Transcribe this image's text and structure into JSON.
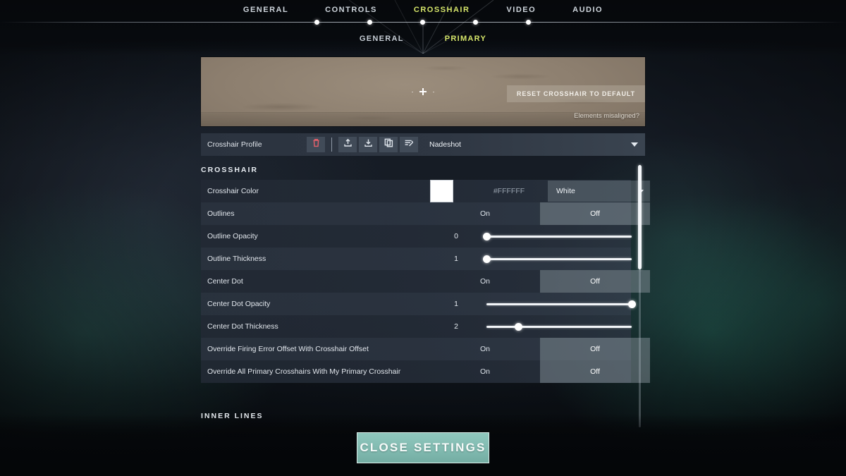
{
  "nav": {
    "tabs": [
      {
        "label": "GENERAL",
        "active": false
      },
      {
        "label": "CONTROLS",
        "active": false
      },
      {
        "label": "CROSSHAIR",
        "active": true
      },
      {
        "label": "VIDEO",
        "active": false
      },
      {
        "label": "AUDIO",
        "active": false
      }
    ],
    "subtabs": [
      {
        "label": "GENERAL",
        "active": false
      },
      {
        "label": "PRIMARY",
        "active": true
      }
    ],
    "active_color": "#D6E66A"
  },
  "preview": {
    "reset_button": "RESET CROSSHAIR TO DEFAULT",
    "misaligned_link": "Elements misaligned?"
  },
  "profile": {
    "label": "Crosshair Profile",
    "selected": "Nadeshot",
    "icons": [
      {
        "name": "delete-icon",
        "glyph": "trash"
      },
      {
        "name": "import-icon",
        "glyph": "upload"
      },
      {
        "name": "export-icon",
        "glyph": "download"
      },
      {
        "name": "duplicate-icon",
        "glyph": "copy"
      },
      {
        "name": "rename-icon",
        "glyph": "edit-list"
      }
    ]
  },
  "sections": {
    "crosshair_title": "CROSSHAIR",
    "inner_lines_title": "INNER LINES"
  },
  "rows": [
    {
      "label": "Crosshair Color",
      "type": "color",
      "hex": "#FFFFFF",
      "swatch_color": "#FFFFFF",
      "preset": "White"
    },
    {
      "label": "Outlines",
      "type": "toggle",
      "options": [
        "On",
        "Off"
      ],
      "selected": "Off"
    },
    {
      "label": "Outline Opacity",
      "type": "slider",
      "value": "0",
      "percent": 0
    },
    {
      "label": "Outline Thickness",
      "type": "slider",
      "value": "1",
      "percent": 0
    },
    {
      "label": "Center Dot",
      "type": "toggle",
      "options": [
        "On",
        "Off"
      ],
      "selected": "Off"
    },
    {
      "label": "Center Dot Opacity",
      "type": "slider",
      "value": "1",
      "percent": 100
    },
    {
      "label": "Center Dot Thickness",
      "type": "slider",
      "value": "2",
      "percent": 22
    },
    {
      "label": "Override Firing Error Offset With Crosshair Offset",
      "type": "toggle",
      "options": [
        "On",
        "Off"
      ],
      "selected": "Off"
    },
    {
      "label": "Override All Primary Crosshairs With My Primary Crosshair",
      "type": "toggle",
      "options": [
        "On",
        "Off"
      ],
      "selected": "Off"
    }
  ],
  "footer": {
    "close_label": "CLOSE SETTINGS"
  }
}
